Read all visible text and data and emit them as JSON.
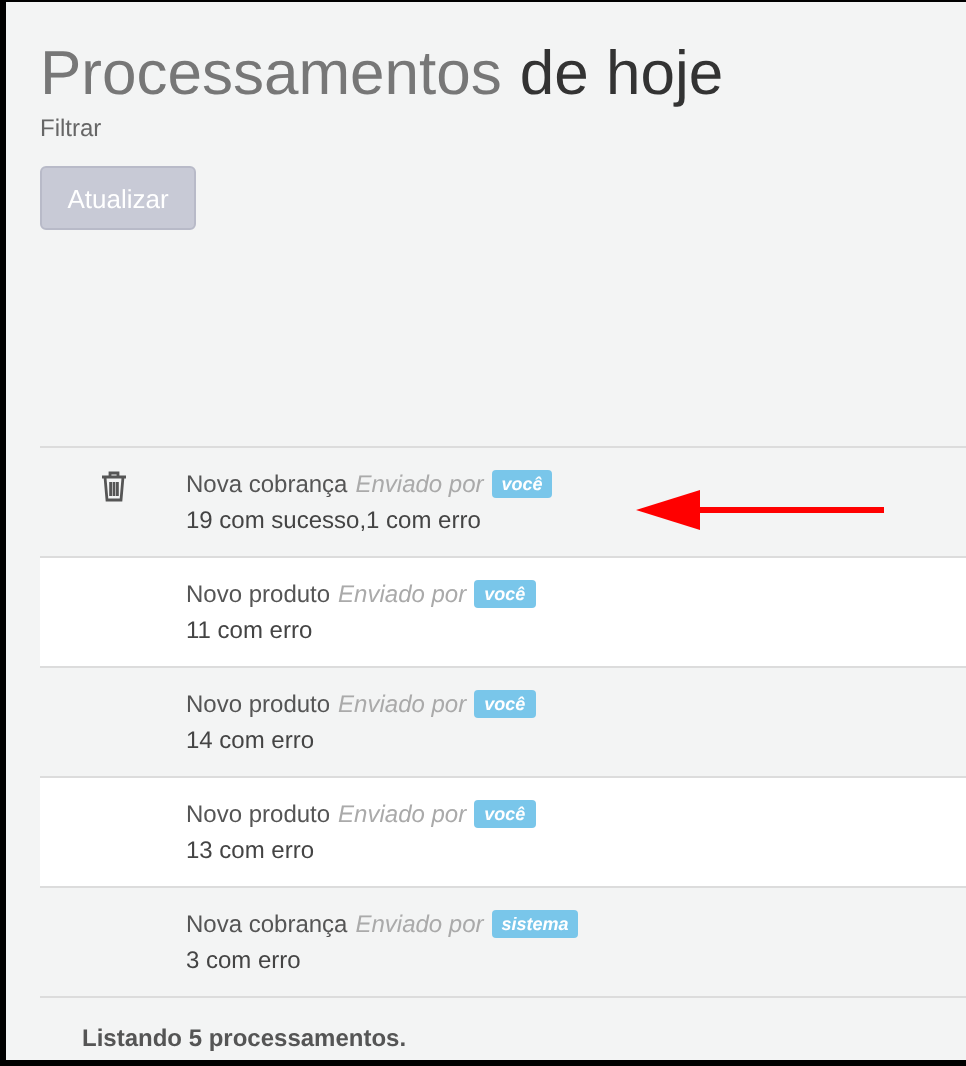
{
  "header": {
    "title_lead": "Processamentos",
    "title_rest": "de hoje",
    "filter_link": "Filtrar",
    "refresh_button": {
      "label": "Atualizar",
      "disabled": true
    }
  },
  "items": [
    {
      "type": "Nova cobrança",
      "sent_by": "Enviado por",
      "sender": "você",
      "summary": "19 com sucesso,1 com erro",
      "deletable": true,
      "annotated": true
    },
    {
      "type": "Novo produto",
      "sent_by": "Enviado por",
      "sender": "você",
      "summary": "11 com erro",
      "deletable": false,
      "annotated": false
    },
    {
      "type": "Novo produto",
      "sent_by": "Enviado por",
      "sender": "você",
      "summary": "14 com erro",
      "deletable": false,
      "annotated": false
    },
    {
      "type": "Novo produto",
      "sent_by": "Enviado por",
      "sender": "você",
      "summary": "13 com erro",
      "deletable": false,
      "annotated": false
    },
    {
      "type": "Nova cobrança",
      "sent_by": "Enviado por",
      "sender": "sistema",
      "summary": "3 com erro",
      "deletable": false,
      "annotated": false
    }
  ],
  "footer": "Listando 5 processamentos."
}
